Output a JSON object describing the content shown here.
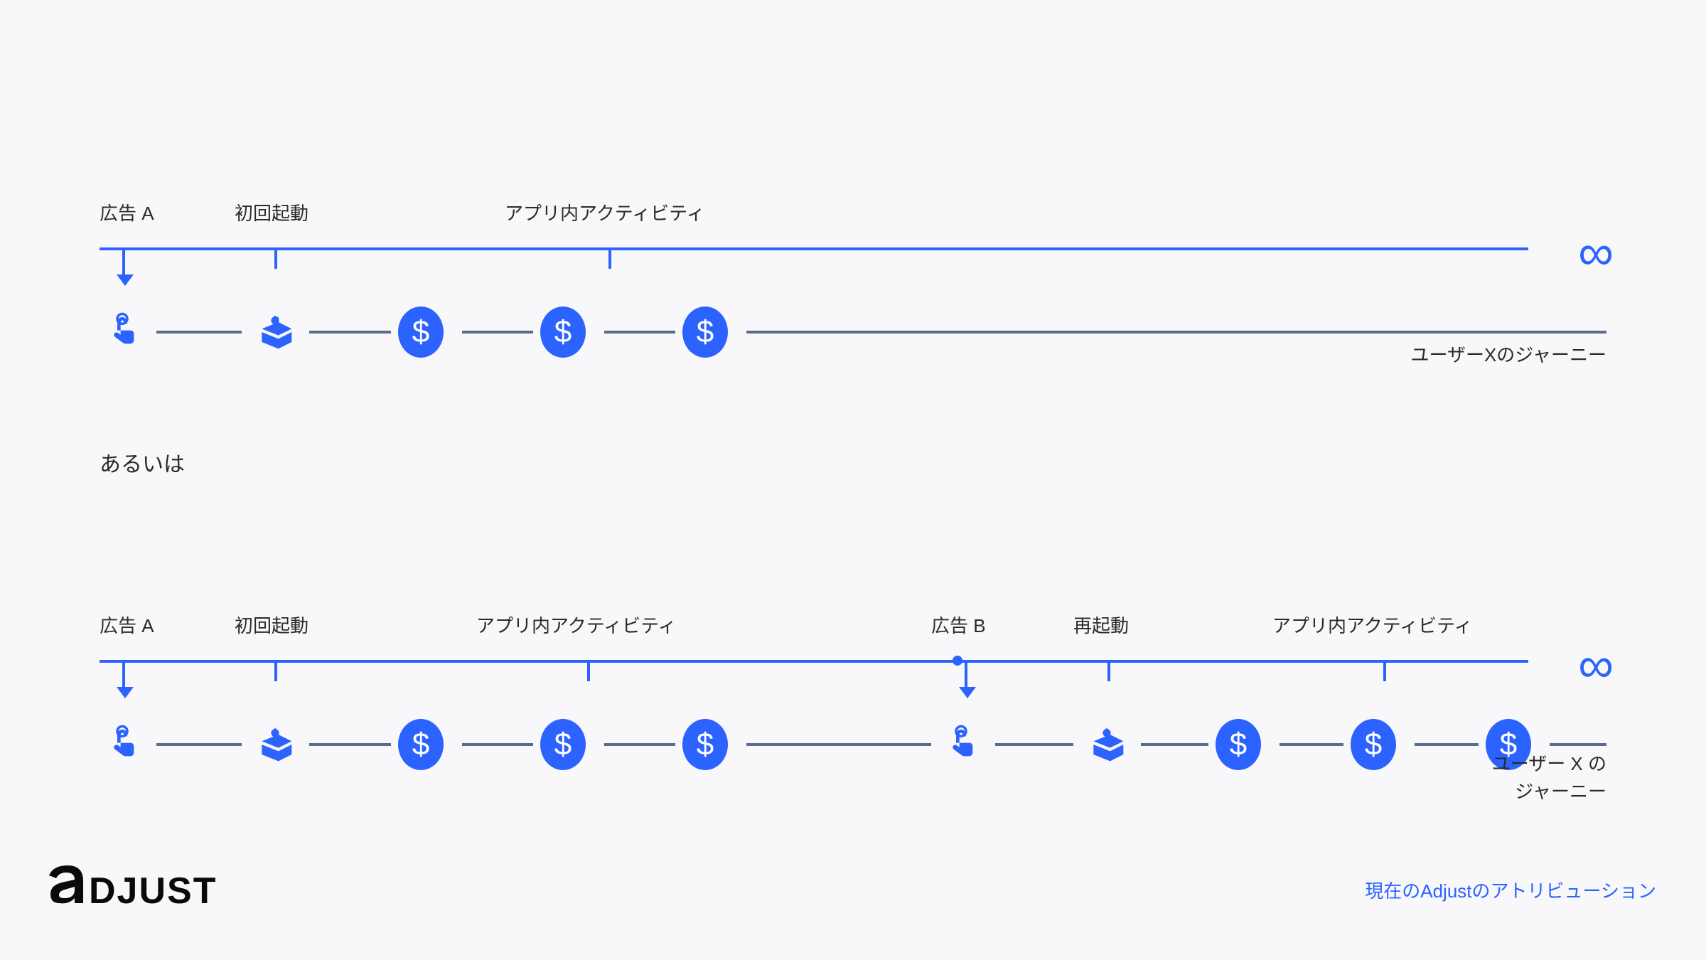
{
  "colors": {
    "accent": "#2c63ff",
    "text": "#2a2a2a",
    "connector": "#5a6b8c"
  },
  "journey1": {
    "labels": {
      "ad_a": "広告 A",
      "first_launch": "初回起動",
      "in_app_activity": "アプリ内アクティビティ"
    },
    "end_label": "ユーザーXのジャーニー",
    "infinity": "∞",
    "dollar": "$"
  },
  "separator": "あるいは",
  "journey2": {
    "labels": {
      "ad_a": "広告 A",
      "first_launch": "初回起動",
      "in_app_activity_1": "アプリ内アクティビティ",
      "ad_b": "広告 B",
      "relaunch": "再起動",
      "in_app_activity_2": "アプリ内アクティビティ"
    },
    "end_label": "ユーザー X の\nジャーニー",
    "infinity": "∞",
    "dollar": "$"
  },
  "logo_text": "ADJUST",
  "footer": "現在のAdjustのアトリビューション",
  "icons": {
    "tap": "tap-icon",
    "unbox": "unbox-gear-icon",
    "dollar": "dollar-circle-icon",
    "infinity": "infinity-icon"
  }
}
